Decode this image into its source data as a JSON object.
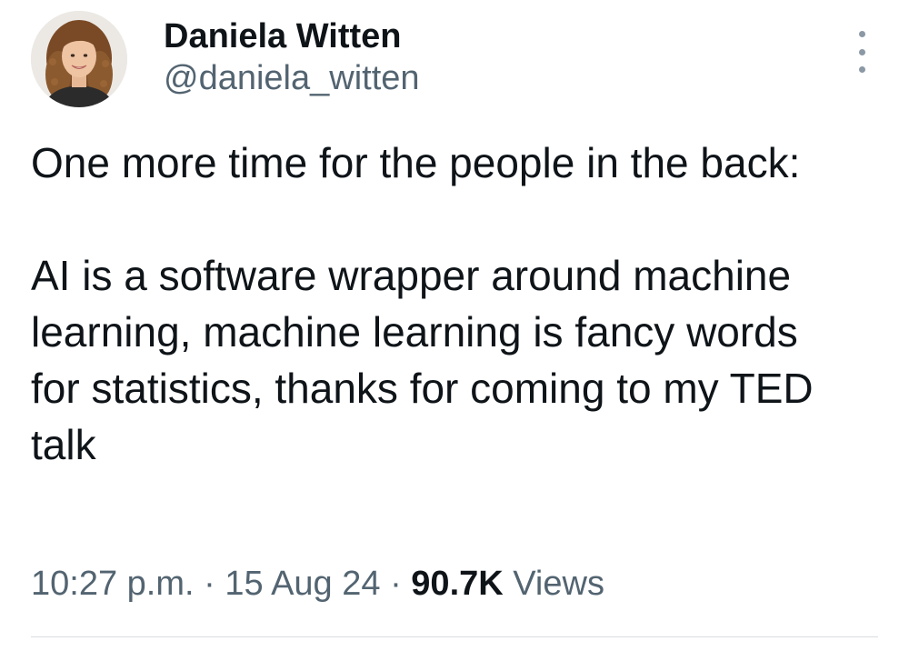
{
  "author": {
    "display_name": "Daniela Witten",
    "handle": "@daniela_witten",
    "avatar_icon": "profile-photo"
  },
  "post": {
    "paragraphs": [
      "One more time for the people in the back:",
      "AI is a software wrapper around machine learning, machine learning is fancy words for statistics, thanks for coming to my TED talk"
    ]
  },
  "meta": {
    "time": "10:27 p.m.",
    "separator": "·",
    "date": "15 Aug 24",
    "views_count": "90.7K",
    "views_label": "Views"
  },
  "actions": {
    "more_icon": "more-vertical-icon"
  },
  "colors": {
    "text_primary": "#0f1419",
    "text_secondary": "#536471",
    "divider": "#d9dde0"
  }
}
